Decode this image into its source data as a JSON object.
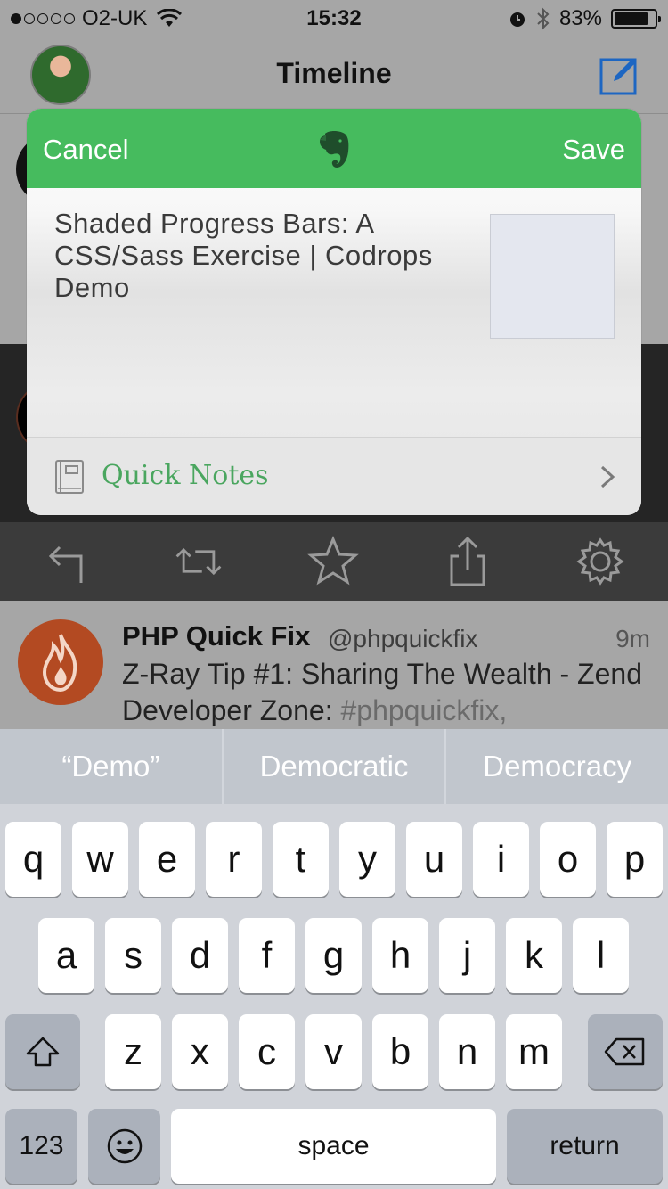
{
  "status_bar": {
    "carrier": "O2-UK",
    "time": "15:32",
    "battery": "83%"
  },
  "nav": {
    "title": "Timeline"
  },
  "share_sheet": {
    "cancel_label": "Cancel",
    "save_label": "Save",
    "note_title": "Shaded Progress Bars: A CSS/Sass Exercise | Codrops Demo",
    "notebook": "Quick Notes",
    "accent_color": "#46bb5e"
  },
  "tweet": {
    "name": "PHP Quick Fix",
    "handle": "@phpquickfix",
    "time": "9m",
    "text": "Z-Ray Tip #1: Sharing The Wealth - Zend Developer Zone:",
    "hashtag": "#phpquickfix,"
  },
  "predictions": [
    "“Demo”",
    "Democratic",
    "Democracy"
  ],
  "keyboard": {
    "row1": [
      "q",
      "w",
      "e",
      "r",
      "t",
      "y",
      "u",
      "i",
      "o",
      "p"
    ],
    "row2": [
      "a",
      "s",
      "d",
      "f",
      "g",
      "h",
      "j",
      "k",
      "l"
    ],
    "row3": [
      "z",
      "x",
      "c",
      "v",
      "b",
      "n",
      "m"
    ],
    "numbers_label": "123",
    "space_label": "space",
    "return_label": "return"
  }
}
